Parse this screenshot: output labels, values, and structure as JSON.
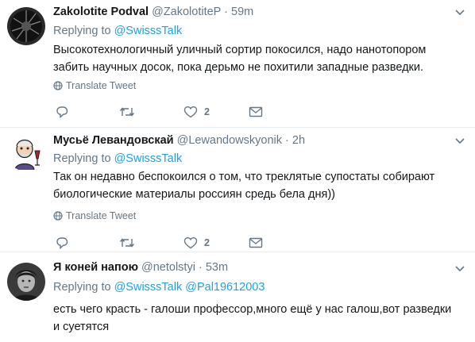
{
  "tweets": [
    {
      "name": "Zakolotite Podval",
      "handle": "@ZakolotiteP",
      "separator": "·",
      "time": "59m",
      "replying_prefix": "Replying to",
      "replying_mentions": [
        "@SwisssTalk"
      ],
      "text_lines": [
        "Высокотехнологичный уличный сортир покосился, надо нанотопором",
        "забить научных досок, пока дерьмо не похитили западные разведки."
      ],
      "translate_label": "Translate Tweet",
      "reply_count": "",
      "retweet_count": "",
      "like_count": "2"
    },
    {
      "name": "Мусьё Левандовскай",
      "handle": "@Lewandowskyonik",
      "separator": "·",
      "time": "2h",
      "replying_prefix": "Replying to",
      "replying_mentions": [
        "@SwisssTalk"
      ],
      "text_lines": [
        "Так он недавно беспокоился о том, что треклятые супостаты собирают",
        "биологические материалы россиян средь бела дня))"
      ],
      "translate_label": "Translate Tweet",
      "reply_count": "",
      "retweet_count": "",
      "like_count": "2"
    },
    {
      "name": "Я коней напою",
      "handle": "@netolstyi",
      "separator": "·",
      "time": "53m",
      "replying_prefix": "Replying to",
      "replying_mentions": [
        "@SwisssTalk",
        "@Pal19612003"
      ],
      "text_lines": [
        "есть чего красть - галоши профессор,много ещё у нас галош,вот разведки",
        "и суетятся"
      ]
    }
  ],
  "colors": {
    "link": "#1da1f2",
    "secondary_text": "#657786",
    "primary_text": "#14171a",
    "divider": "#e6ecf0"
  },
  "icons": [
    "chevron-down-icon",
    "globe-icon",
    "reply-icon",
    "retweet-icon",
    "heart-icon",
    "direct-message-icon"
  ]
}
